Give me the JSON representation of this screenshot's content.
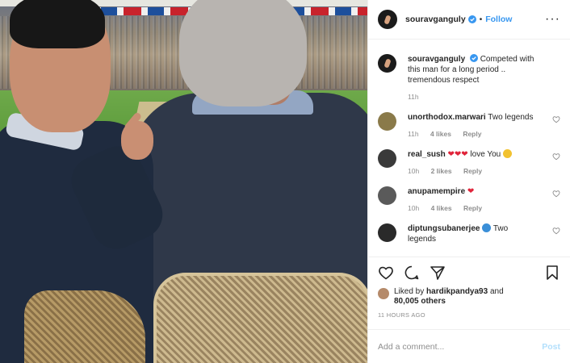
{
  "header": {
    "username": "souravganguly",
    "separator": "•",
    "follow_label": "Follow",
    "more_icon": "more-horizontal-icon",
    "more_label": "···"
  },
  "caption": {
    "username": "souravganguly",
    "text": "Competed with this man for a long period .. tremendous respect",
    "time": "11h"
  },
  "comments": [
    {
      "username": "unorthodox.marwari",
      "text": "Two legends",
      "time": "11h",
      "likes": "4 likes",
      "reply": "Reply"
    },
    {
      "username": "real_sush",
      "emoji": "❤❤❤",
      "text": "love You",
      "time": "10h",
      "likes": "2 likes",
      "reply": "Reply"
    },
    {
      "username": "anupamempire",
      "emoji": "❤",
      "text": "",
      "time": "10h",
      "likes": "4 likes",
      "reply": "Reply"
    },
    {
      "username": "diptungsubanerjee",
      "text": "Two",
      "second_line": "legends"
    }
  ],
  "likes": {
    "prefix": "Liked by",
    "user": "hardikpandya93",
    "and": "and",
    "others": "80,005 others"
  },
  "timestamp": "11 HOURS AGO",
  "add_comment": {
    "placeholder": "Add a comment...",
    "post_label": "Post"
  },
  "colors": {
    "link": "#3897f0",
    "post_disabled": "#b2dffc",
    "heart": "#e0243a",
    "muted": "#8e8e8e"
  }
}
